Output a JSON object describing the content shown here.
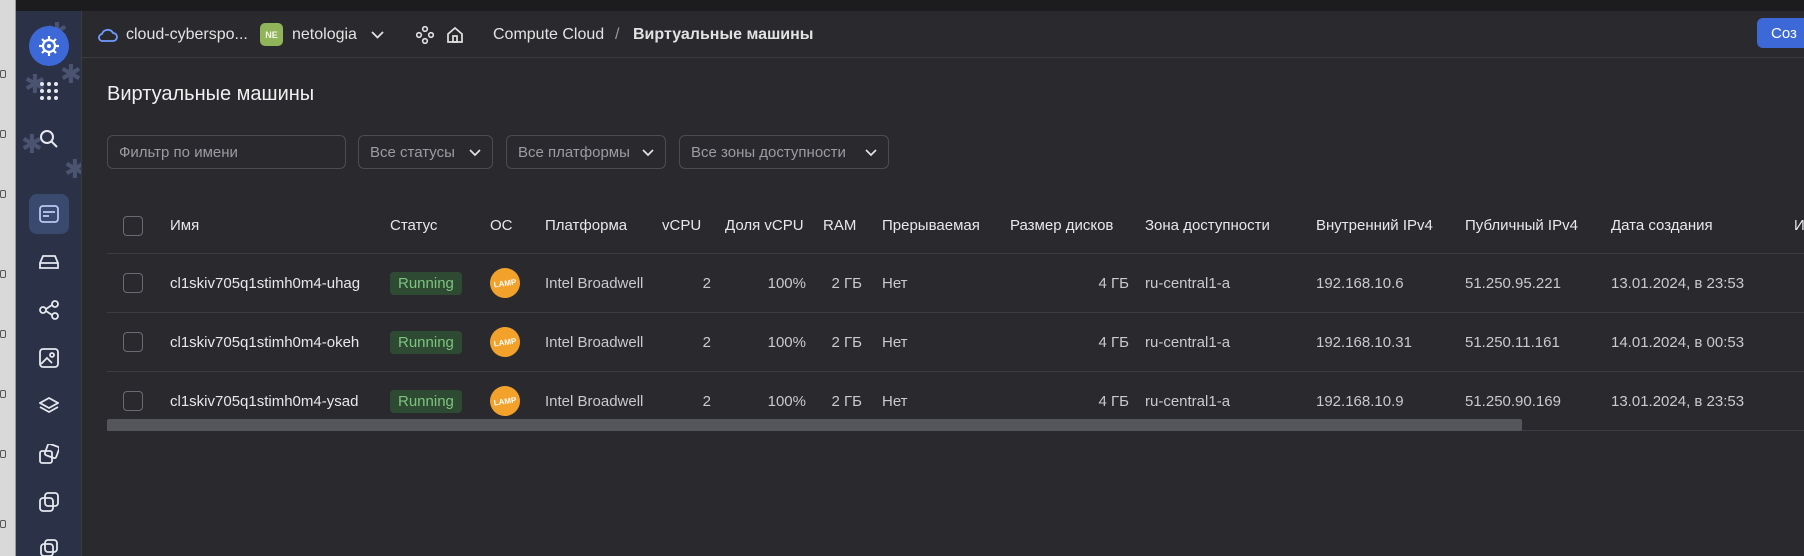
{
  "header": {
    "cloud_name": "cloud-cyberspo...",
    "folder_badge": "NE",
    "folder_name": "netologia",
    "service": "Compute Cloud",
    "separator": "/",
    "current_page": "Виртуальные машины",
    "create_button": "Соз"
  },
  "sidebar": {
    "icons": [
      "logo-icon",
      "apps-grid-icon",
      "search-icon",
      "dashboard-icon",
      "disk-icon",
      "network-icon",
      "image-icon",
      "layers-icon",
      "instance-groups-icon",
      "snapshots-icon",
      "more-icon"
    ],
    "accent": "#3d69d8"
  },
  "page": {
    "title": "Виртуальные машины"
  },
  "filters": {
    "name_placeholder": "Фильтр по имени",
    "status": "Все статусы",
    "platform": "Все платформы",
    "zone": "Все зоны доступности"
  },
  "table": {
    "columns": [
      "Имя",
      "Статус",
      "ОС",
      "Платформа",
      "vCPU",
      "Доля vCPU",
      "RAM",
      "Прерываемая",
      "Размер дисков",
      "Зона доступности",
      "Внутренний IPv4",
      "Публичный IPv4",
      "Дата создания",
      "И"
    ],
    "rows": [
      {
        "name": "cl1skiv705q1stimh0m4-uhag",
        "status": "Running",
        "os": "LAMP",
        "platform": "Intel Broadwell",
        "vcpu": "2",
        "vcpu_share": "100%",
        "ram": "2 ГБ",
        "preemptible": "Нет",
        "disk_size": "4 ГБ",
        "zone": "ru-central1-a",
        "internal_ip": "192.168.10.6",
        "public_ip": "51.250.95.221",
        "created": "13.01.2024, в 23:53"
      },
      {
        "name": "cl1skiv705q1stimh0m4-okeh",
        "status": "Running",
        "os": "LAMP",
        "platform": "Intel Broadwell",
        "vcpu": "2",
        "vcpu_share": "100%",
        "ram": "2 ГБ",
        "preemptible": "Нет",
        "disk_size": "4 ГБ",
        "zone": "ru-central1-a",
        "internal_ip": "192.168.10.31",
        "public_ip": "51.250.11.161",
        "created": "14.01.2024, в 00:53"
      },
      {
        "name": "cl1skiv705q1stimh0m4-ysad",
        "status": "Running",
        "os": "LAMP",
        "platform": "Intel Broadwell",
        "vcpu": "2",
        "vcpu_share": "100%",
        "ram": "2 ГБ",
        "preemptible": "Нет",
        "disk_size": "4 ГБ",
        "zone": "ru-central1-a",
        "internal_ip": "192.168.10.9",
        "public_ip": "51.250.90.169",
        "created": "13.01.2024, в 23:53"
      }
    ],
    "status_color": "#7cc47d"
  }
}
